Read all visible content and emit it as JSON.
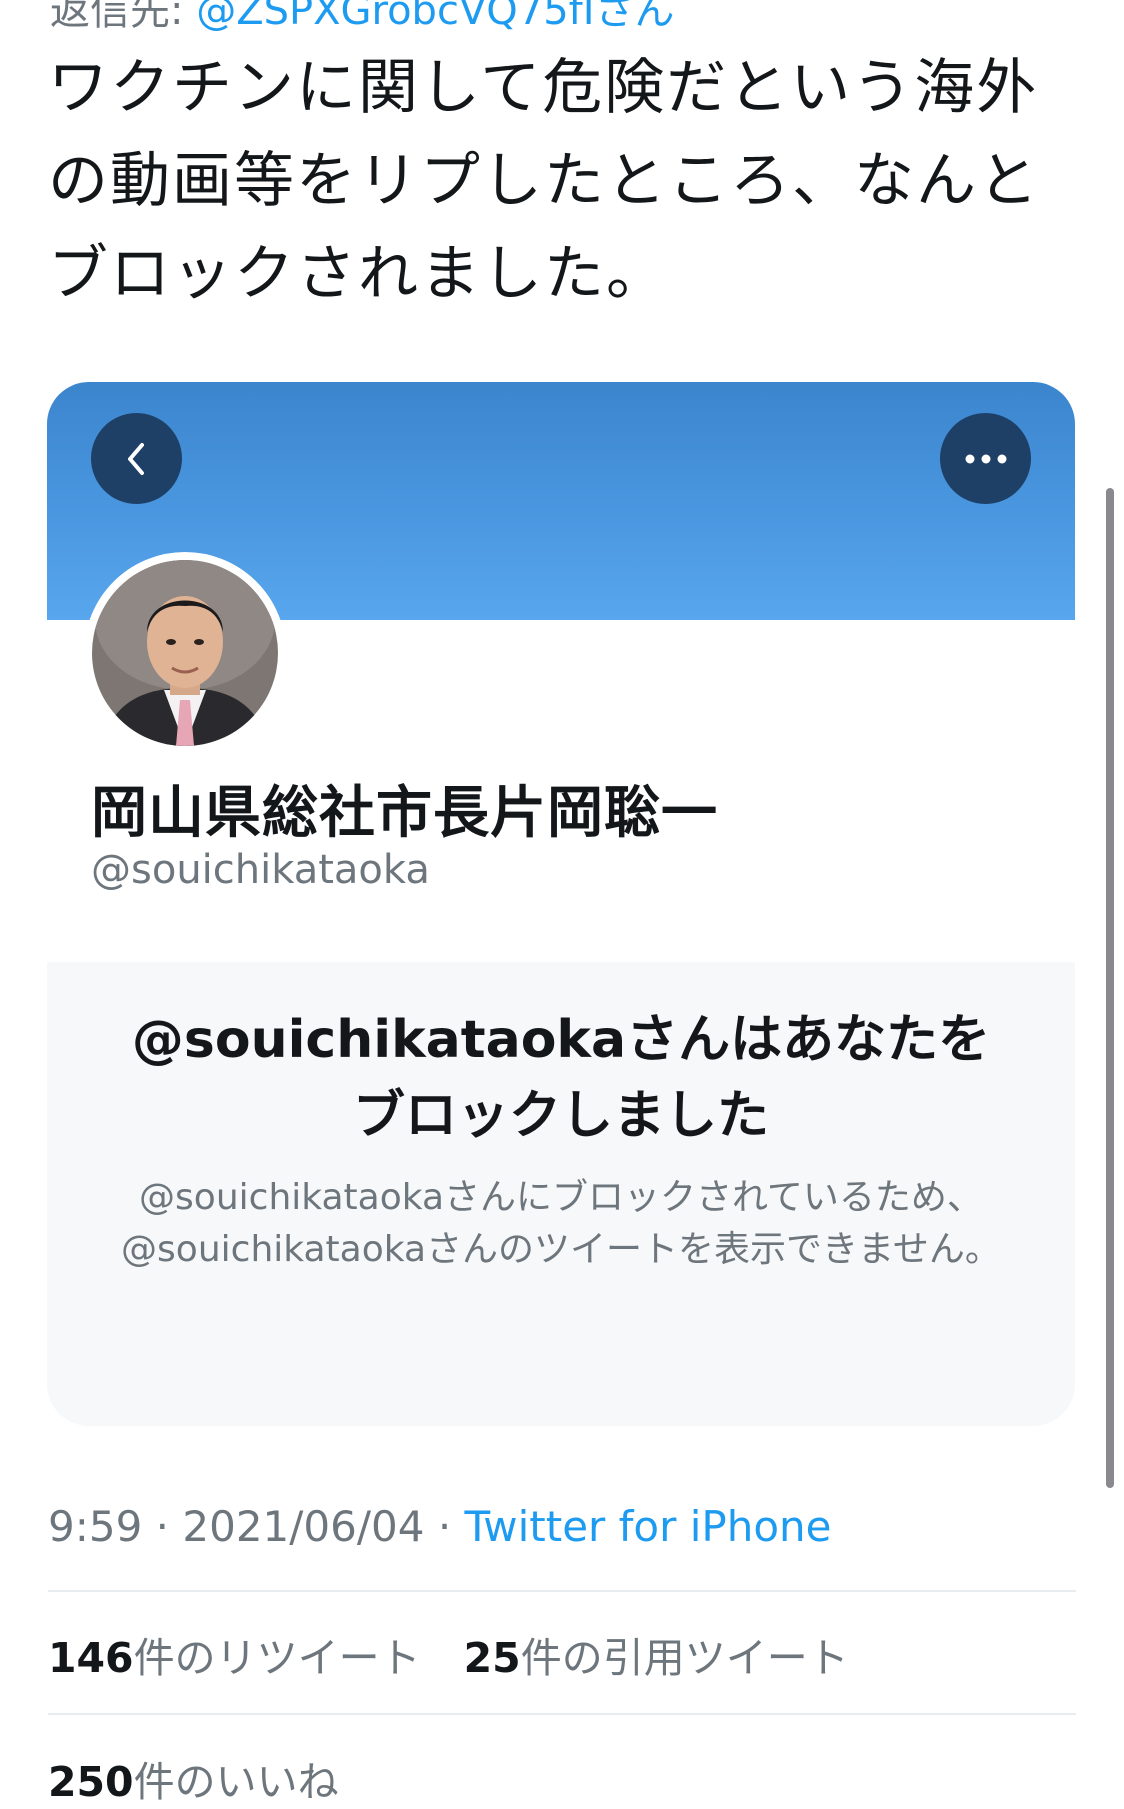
{
  "reply_to": {
    "prefix": "返信先: ",
    "handle": "@ZSPXGrobcVQ75fIさん"
  },
  "tweet": {
    "text": "ワクチンに関して危険だという海外\nの動画等をリプしたところ、なんと\nブロックされました。"
  },
  "embedded_profile": {
    "display_name": "岡山県総社市長片岡聡一",
    "screen_name": "@souichikataoka",
    "back_icon": "chevron-left-icon",
    "more_icon": "ellipsis-icon",
    "banner_color": "#4a97e0",
    "blocked_title": "@souichikataokaさんはあなたを\nブロックしました",
    "blocked_description": "@souichikataokaさんにブロックされているため、\n@souichikataokaさんのツイートを表示できません。"
  },
  "meta": {
    "time": "9:59",
    "separator": " · ",
    "date": "2021/06/04",
    "source": "Twitter for iPhone"
  },
  "stats": {
    "retweets_count": "146",
    "retweets_label": "件のリツイート",
    "quotes_count": "25",
    "quotes_label": "件の引用ツイート",
    "likes_count": "250",
    "likes_label": "件のいいね"
  },
  "colors": {
    "link": "#1d9bf0",
    "secondary_text": "#6e767d",
    "panel_bg": "#f7f8f9"
  }
}
